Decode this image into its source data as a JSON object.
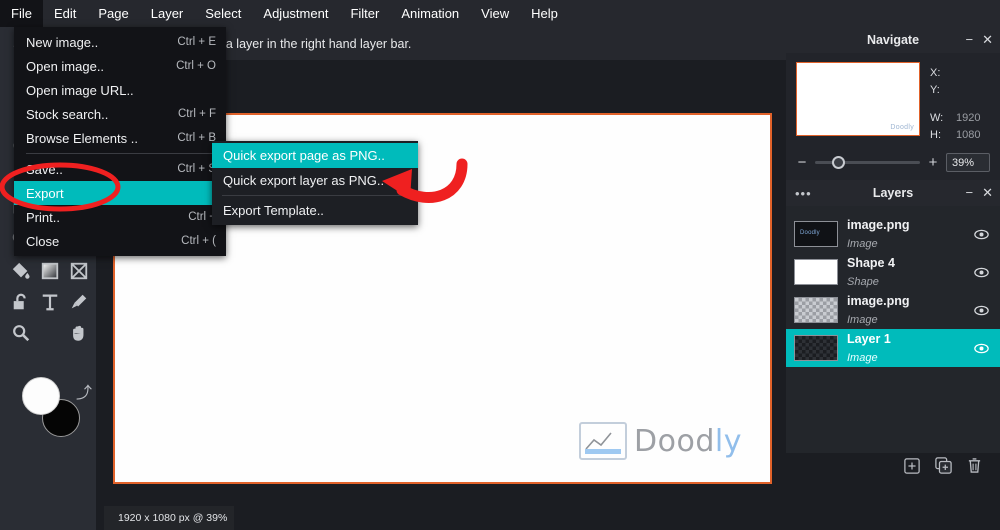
{
  "app": {
    "canvas_hint": "elect a layer in the right hand layer bar.",
    "status": "1920 x 1080 px @ 39%",
    "watermark_text_1": "Dood",
    "watermark_text_2": "ly",
    "accent_teal": "#00bbbb",
    "canvas_border": "#e1622a",
    "annotation_red": "#ef2020"
  },
  "menubar": {
    "items": [
      {
        "label": "File"
      },
      {
        "label": "Edit"
      },
      {
        "label": "Page"
      },
      {
        "label": "Layer"
      },
      {
        "label": "Select"
      },
      {
        "label": "Adjustment"
      },
      {
        "label": "Filter"
      },
      {
        "label": "Animation"
      },
      {
        "label": "View"
      },
      {
        "label": "Help"
      }
    ]
  },
  "file_menu": {
    "items": [
      {
        "label": "New image..",
        "shortcut": "Ctrl + E"
      },
      {
        "label": "Open image..",
        "shortcut": "Ctrl + O"
      },
      {
        "label": "Open image URL..",
        "shortcut": ""
      },
      {
        "label": "Stock search..",
        "shortcut": "Ctrl + F"
      },
      {
        "label": "Browse Elements ..",
        "shortcut": "Ctrl + B"
      },
      {
        "label": "Save..",
        "shortcut": "Ctrl + S"
      },
      {
        "label": "Export",
        "shortcut": ""
      },
      {
        "label": "Print..",
        "shortcut": "Ctrl +"
      },
      {
        "label": "Close",
        "shortcut": "Ctrl + ("
      }
    ]
  },
  "export_submenu": {
    "items": [
      {
        "label": "Quick export page as PNG.."
      },
      {
        "label": "Quick export layer as PNG.."
      },
      {
        "label": "Export Template.."
      }
    ]
  },
  "tools": {
    "items": [
      {
        "name": "paint-bucket-tool"
      },
      {
        "name": "gradient-tool"
      },
      {
        "name": "transparency-tool"
      },
      {
        "name": "lock-tool"
      },
      {
        "name": "text-tool"
      },
      {
        "name": "eyedropper-tool"
      },
      {
        "name": "zoom-tool"
      },
      {
        "name": "hand-tool"
      }
    ]
  },
  "navigate": {
    "title": "Navigate",
    "thumb_watermark": "Doodly",
    "fields": [
      {
        "key": "X:",
        "value": ""
      },
      {
        "key": "Y:",
        "value": ""
      },
      {
        "key": "W:",
        "value": "1920"
      },
      {
        "key": "H:",
        "value": "1080"
      }
    ],
    "zoom_minus": "−",
    "zoom_plus": "+",
    "zoom_value": "39%"
  },
  "layers": {
    "title": "Layers",
    "items": [
      {
        "name": "image.png",
        "type": "Image",
        "thumb": "dark-img",
        "selected": false
      },
      {
        "name": "Shape 4",
        "type": "Shape",
        "thumb": "white",
        "selected": false
      },
      {
        "name": "image.png",
        "type": "Image",
        "thumb": "checker",
        "selected": false
      },
      {
        "name": "Layer 1",
        "type": "Image",
        "thumb": "dark-checker",
        "selected": true
      }
    ],
    "footer": [
      {
        "name": "add-layer-icon"
      },
      {
        "name": "duplicate-layer-icon"
      },
      {
        "name": "delete-layer-icon"
      }
    ]
  }
}
